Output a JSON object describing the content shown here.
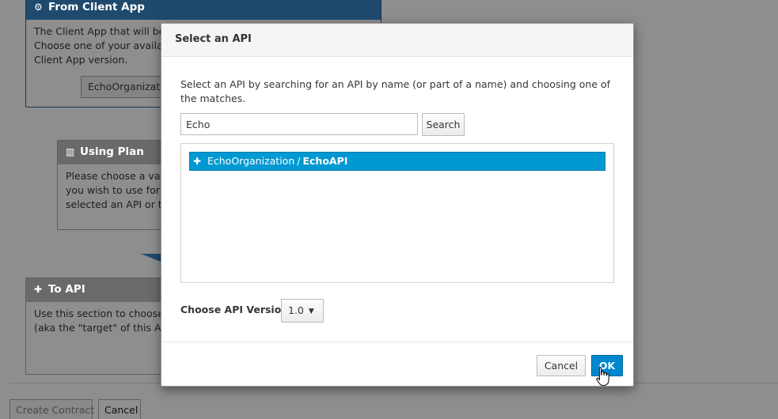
{
  "background": {
    "from_client_app": {
      "title": "From Client App",
      "icon": "cogs-icon",
      "text_line1": "The Client App that will be",
      "text_line2": "Choose one of your availa",
      "text_line3": "Client App version.",
      "select_value": "EchoOrganization"
    },
    "using_plan": {
      "title": "Using Plan",
      "icon": "bar-chart-icon",
      "text_line1": "Please choose a vali",
      "text_line2": "you wish to use for t",
      "text_line3": "selected an API or th"
    },
    "to_api": {
      "title": "To API",
      "icon": "puzzle-icon",
      "text_line1": "Use this section to choose",
      "text_line2": "(aka the \"target\" of this AP"
    },
    "create_contract_label": "Create Contract",
    "cancel_label": "Cancel"
  },
  "modal": {
    "title": "Select an API",
    "description": "Select an API by searching for an API by name (or part of a name) and choosing one of the matches.",
    "search": {
      "value": "Echo",
      "button_label": "Search"
    },
    "results": [
      {
        "organization": "EchoOrganization",
        "separator": "/",
        "api": "EchoAPI",
        "icon": "puzzle-icon",
        "selected": true
      }
    ],
    "version": {
      "label": "Choose API Version:",
      "value": "1.0"
    },
    "footer": {
      "cancel_label": "Cancel",
      "ok_label": "OK"
    }
  },
  "colors": {
    "selected_row": "#0099d3",
    "primary_button": "#0088ce",
    "header_dark": "#1f4a6e"
  }
}
